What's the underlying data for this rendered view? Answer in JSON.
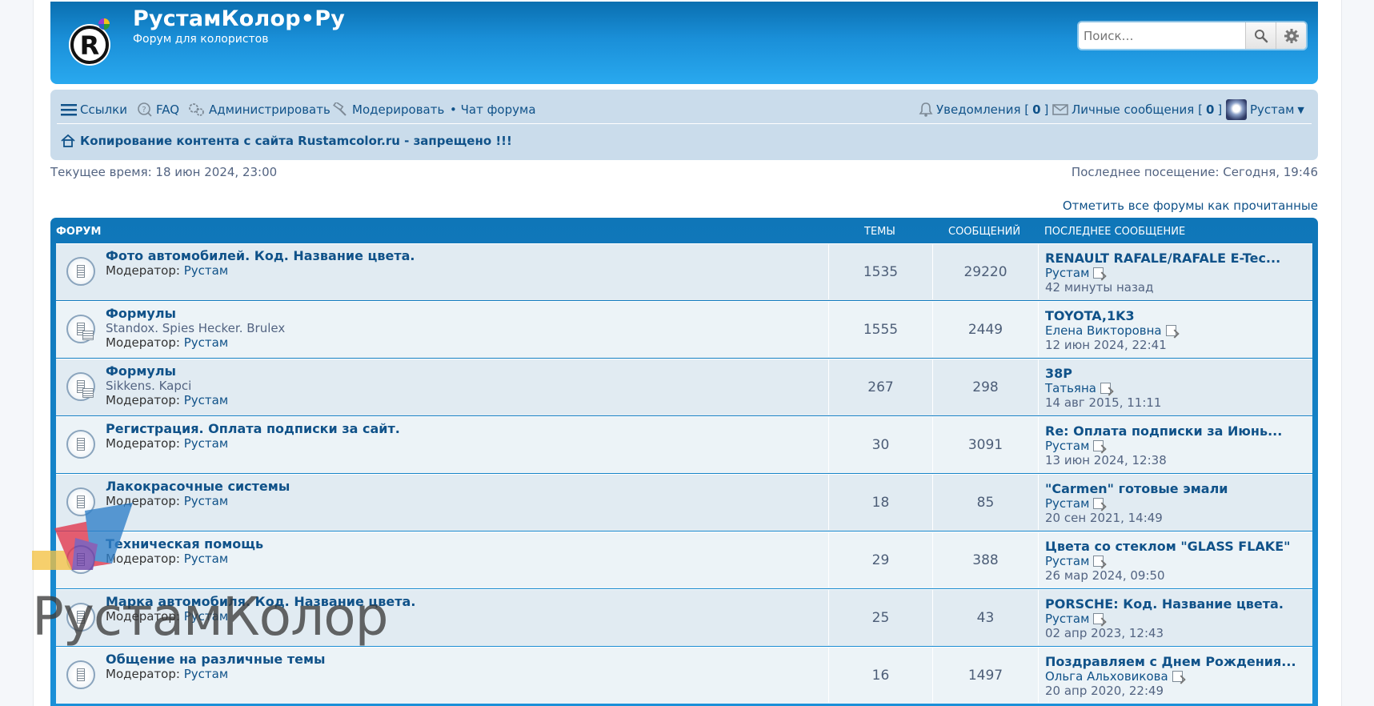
{
  "header": {
    "site_title": "РустамКолор•Ру",
    "site_description": "Форум для колористов",
    "search_placeholder": "Поиск…",
    "search_icon": "magnifier-icon",
    "advanced_search_icon": "gear-icon"
  },
  "navbar": {
    "links_label": "Ссылки",
    "faq_label": "FAQ",
    "admin_label": "Администрировать",
    "moderate_label": "Модерировать",
    "chat_label": "• Чат форума",
    "notifications_label": "Уведомления [",
    "notifications_count": "0",
    "pm_label": "Личные сообщения [",
    "pm_count": "0",
    "bracket_close": "]",
    "user_name": "Рустам",
    "notice": "Копирование контента с сайта Rustamcolor.ru - запрещено !!!"
  },
  "info": {
    "current_time": "Текущее время: 18 июн 2024, 23:00",
    "last_visit": "Последнее посещение: Сегодня, 19:46",
    "mark_read": "Отметить все форумы как прочитанные"
  },
  "table_headers": {
    "forum": "ФОРУМ",
    "topics": "ТЕМЫ",
    "posts": "СООБЩЕНИЙ",
    "last_post": "ПОСЛЕДНЕЕ СООБЩЕНИЕ"
  },
  "moderator_label": "Модератор:",
  "forums": [
    {
      "title": "Фото автомобилей. Код. Название цвета.",
      "desc": "",
      "moderator": "Рустам",
      "topics": "1535",
      "posts": "29220",
      "last_title": "RENAULT RAFALE/RAFALE E-Tec...",
      "last_author": "Рустам",
      "last_date": "42 минуты назад",
      "icon": "forum-read-icon"
    },
    {
      "title": "Формулы",
      "desc": "Standox. Spies Hecker. Brulex",
      "moderator": "Рустам",
      "topics": "1555",
      "posts": "2449",
      "last_title": "TOYOTA,1K3",
      "last_author": "Елена Викторовна",
      "last_date": "12 июн 2024, 22:41",
      "icon": "forum-subforum-icon"
    },
    {
      "title": "Формулы",
      "desc": "Sikkens. Kapci",
      "moderator": "Рустам",
      "topics": "267",
      "posts": "298",
      "last_title": "38P",
      "last_author": "Татьяна",
      "last_date": "14 авг 2015, 11:11",
      "icon": "forum-subforum-icon"
    },
    {
      "title": "Регистрация. Оплата подписки за сайт.",
      "desc": "",
      "moderator": "Рустам",
      "topics": "30",
      "posts": "3091",
      "last_title": "Re: Оплата подписки за Июнь...",
      "last_author": "Рустам",
      "last_date": "13 июн 2024, 12:38",
      "icon": "forum-read-icon"
    },
    {
      "title": "Лакокрасочные системы",
      "desc": "",
      "moderator": "Рустам",
      "topics": "18",
      "posts": "85",
      "last_title": "\"Carmen\" готовые эмали",
      "last_author": "Рустам",
      "last_date": "20 сен 2021, 14:49",
      "icon": "forum-read-icon"
    },
    {
      "title": "Техническая помощь",
      "desc": "",
      "moderator": "Рустам",
      "topics": "29",
      "posts": "388",
      "last_title": "Цвета со стеклом \"GLASS FLAKE\"",
      "last_author": "Рустам",
      "last_date": "26 мар 2024, 09:50",
      "icon": "forum-read-icon"
    },
    {
      "title": "Марка автомобиля. Код. Название цвета.",
      "desc": "",
      "moderator": "Рустам",
      "topics": "25",
      "posts": "43",
      "last_title": "PORSCHE: Код. Название цвета.",
      "last_author": "Рустам",
      "last_date": "02 апр 2023, 12:43",
      "icon": "forum-read-icon"
    },
    {
      "title": "Общение на различные темы",
      "desc": "",
      "moderator": "Рустам",
      "topics": "16",
      "posts": "1497",
      "last_title": "Поздравляем с Днем Рождения...",
      "last_author": "Ольга Альховикова",
      "last_date": "20 апр 2020, 22:49",
      "icon": "forum-read-icon"
    }
  ],
  "watermark": {
    "text": "РустамКолор"
  }
}
